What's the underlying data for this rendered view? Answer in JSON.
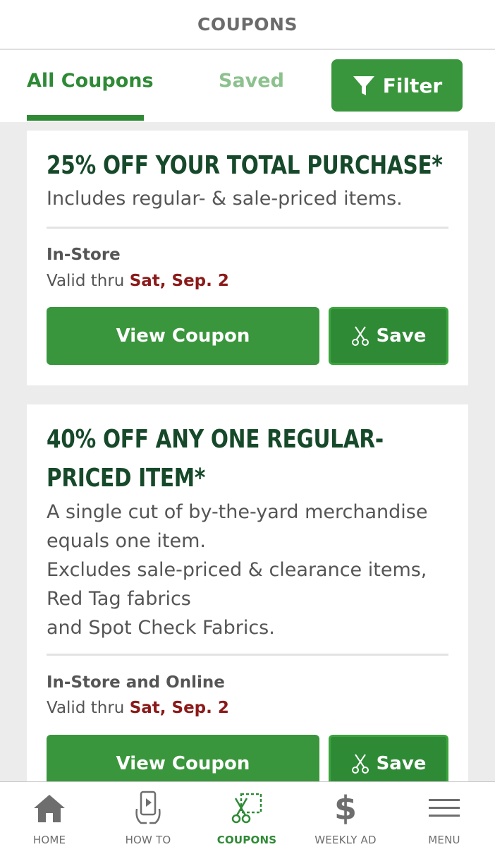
{
  "header": {
    "title": "COUPONS"
  },
  "tabs": {
    "all_label": "All Coupons",
    "saved_label": "Saved",
    "filter_label": "Filter"
  },
  "coupons": [
    {
      "title_lines": [
        "25% OFF YOUR TOTAL PURCHASE*"
      ],
      "description_lines": [
        "Includes regular- & sale-priced items."
      ],
      "availability": "In-Store",
      "valid_prefix": "Valid thru",
      "valid_date": "Sat, Sep. 2",
      "view_label": "View Coupon",
      "save_label": "Save"
    },
    {
      "title_lines": [
        "40% OFF ANY ONE REGULAR-",
        "PRICED ITEM*"
      ],
      "description_lines": [
        "A single cut of by-the-yard merchandise",
        "equals one item.",
        "Excludes sale-priced & clearance items,",
        "Red Tag fabrics",
        "and Spot Check Fabrics."
      ],
      "availability": "In-Store and Online",
      "valid_prefix": "Valid thru",
      "valid_date": "Sat, Sep. 2",
      "view_label": "View Coupon",
      "save_label": "Save"
    }
  ],
  "bottom_nav": {
    "items": [
      {
        "label": "HOME",
        "icon": "home-icon"
      },
      {
        "label": "HOW TO",
        "icon": "how-to-icon"
      },
      {
        "label": "COUPONS",
        "icon": "coupons-icon",
        "active": true
      },
      {
        "label": "WEEKLY AD",
        "icon": "dollar-icon"
      },
      {
        "label": "MENU",
        "icon": "menu-icon"
      }
    ]
  },
  "colors": {
    "accent": "#3a963c",
    "title_green": "#16492a",
    "date_red": "#8b1a1a"
  }
}
